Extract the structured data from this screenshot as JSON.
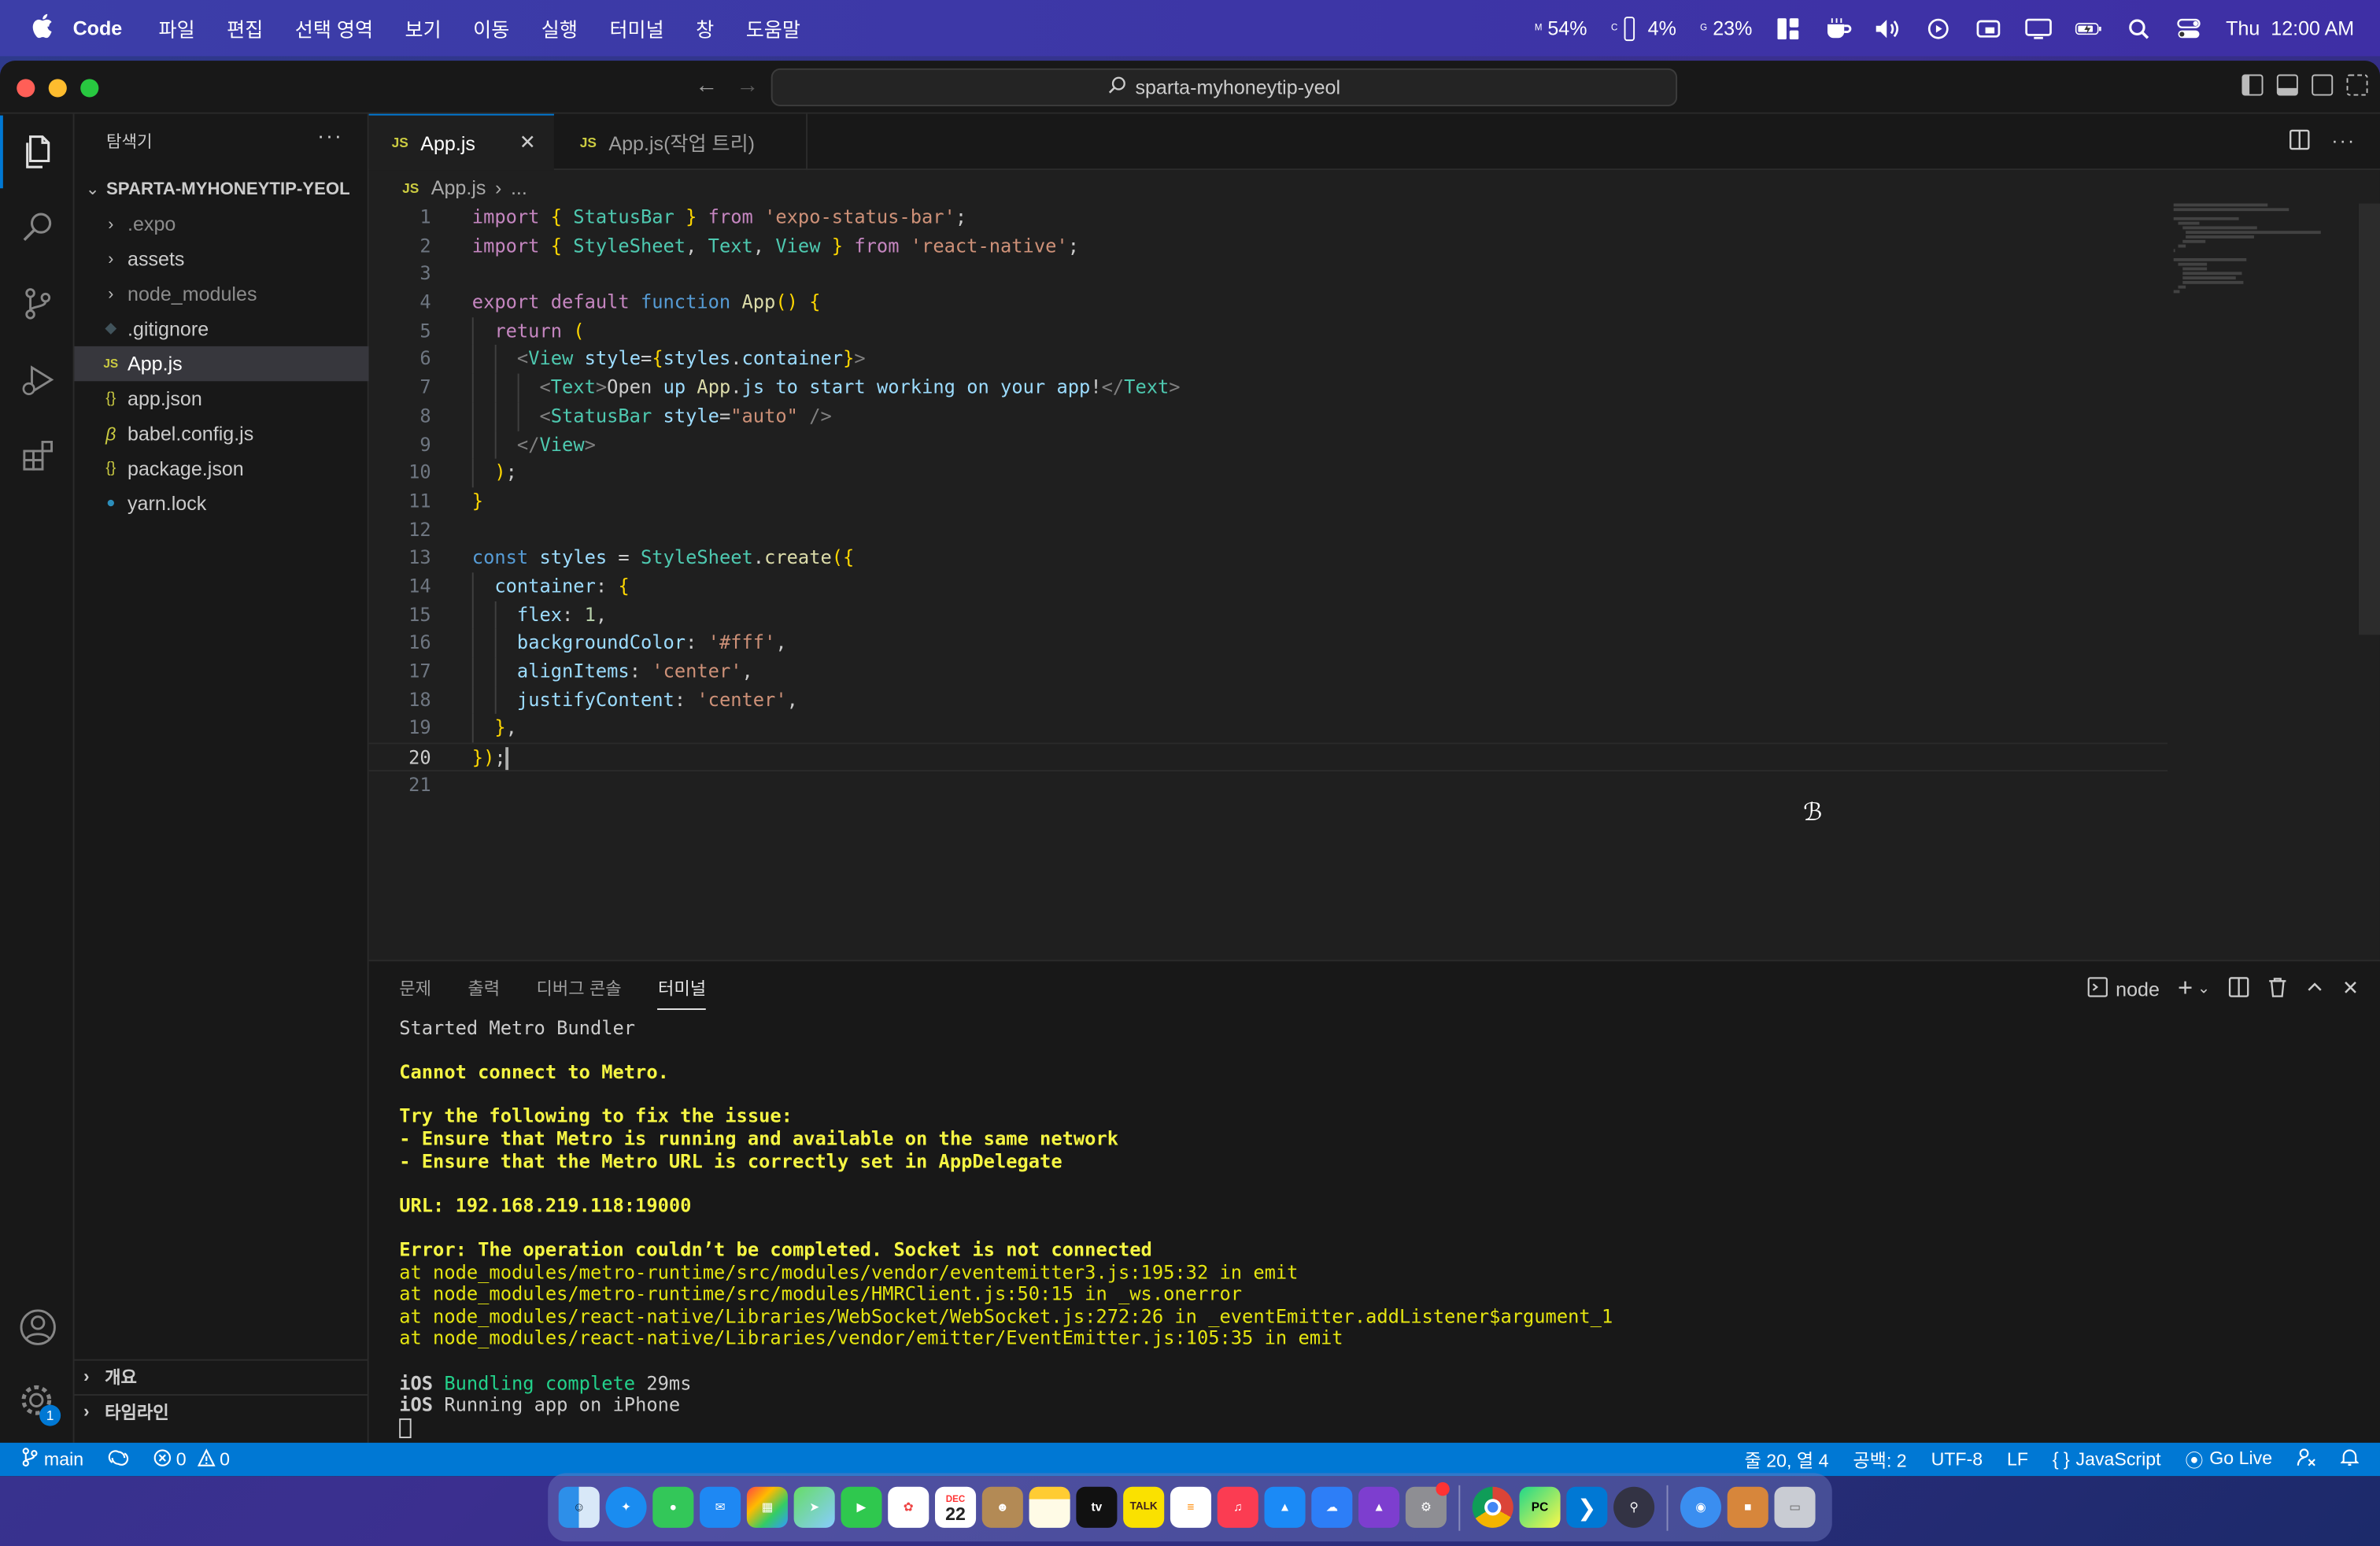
{
  "menubar": {
    "app_name": "Code",
    "items": [
      "파일",
      "편집",
      "선택 영역",
      "보기",
      "이동",
      "실행",
      "터미널",
      "창",
      "도움말"
    ],
    "mem_label": "M",
    "mem_value": "54%",
    "cpu_label": "C",
    "cpu_value": "4%",
    "gpu_label": "G",
    "gpu_value": "23%",
    "clock": "Thu  12:00 AM"
  },
  "titlebar": {
    "search_text": "sparta-myhoneytip-yeol"
  },
  "activity": {
    "settings_badge": "1"
  },
  "sidebar": {
    "title": "탐색기",
    "more": "···",
    "root": "SPARTA-MYHONEYTIP-YEOL",
    "items": [
      {
        "name": ".expo",
        "kind": "folder"
      },
      {
        "name": "assets",
        "kind": "folder"
      },
      {
        "name": "node_modules",
        "kind": "folder"
      },
      {
        "name": ".gitignore",
        "kind": "file"
      },
      {
        "name": "App.js",
        "kind": "js"
      },
      {
        "name": "app.json",
        "kind": "json"
      },
      {
        "name": "babel.config.js",
        "kind": "babel"
      },
      {
        "name": "package.json",
        "kind": "json"
      },
      {
        "name": "yarn.lock",
        "kind": "yarn"
      }
    ],
    "outline": "개요",
    "timeline": "타임라인"
  },
  "editor": {
    "tabs": [
      {
        "label": "App.js",
        "badge": "JS"
      },
      {
        "label": "App.js(작업 트리)",
        "badge": "JS"
      }
    ],
    "breadcrumb_badge": "JS",
    "breadcrumb_file": "App.js",
    "breadcrumb_more": "...",
    "current_line": 20,
    "lines": [
      "import { StatusBar } from 'expo-status-bar';",
      "import { StyleSheet, Text, View } from 'react-native';",
      "",
      "export default function App() {",
      "  return (",
      "    <View style={styles.container}>",
      "      <Text>Open up App.js to start working on your app!</Text>",
      "      <StatusBar style=\"auto\" />",
      "    </View>",
      "  );",
      "}",
      "",
      "const styles = StyleSheet.create({",
      "  container: {",
      "    flex: 1,",
      "    backgroundColor: '#fff',",
      "    alignItems: 'center',",
      "    justifyContent: 'center',",
      "  },",
      "});",
      ""
    ]
  },
  "panel": {
    "tabs": [
      "문제",
      "출력",
      "디버그 콘솔",
      "터미널"
    ],
    "active_tab": "터미널",
    "shell": "node",
    "terminal": [
      {
        "text": "Started Metro Bundler",
        "style": "normal"
      },
      {
        "text": "",
        "style": "normal"
      },
      {
        "text": "Cannot connect to Metro.",
        "style": "yellow-bold"
      },
      {
        "text": "",
        "style": "normal"
      },
      {
        "text": "Try the following to fix the issue:",
        "style": "yellow-bold"
      },
      {
        "text": "- Ensure that Metro is running and available on the same network",
        "style": "yellow-bold"
      },
      {
        "text": "- Ensure that the Metro URL is correctly set in AppDelegate",
        "style": "yellow-bold"
      },
      {
        "text": "",
        "style": "normal"
      },
      {
        "text": "URL: 192.168.219.118:19000",
        "style": "yellow-bold"
      },
      {
        "text": "",
        "style": "normal"
      },
      {
        "text": "Error: The operation couldn’t be completed. Socket is not connected",
        "style": "yellow-bold"
      },
      {
        "text": "at node_modules/metro-runtime/src/modules/vendor/eventemitter3.js:195:32 in emit",
        "style": "yellow"
      },
      {
        "text": "at node_modules/metro-runtime/src/modules/HMRClient.js:50:15 in _ws.onerror",
        "style": "yellow"
      },
      {
        "text": "at node_modules/react-native/Libraries/WebSocket/WebSocket.js:272:26 in _eventEmitter.addListener$argument_1",
        "style": "yellow"
      },
      {
        "text": "at node_modules/react-native/Libraries/vendor/emitter/EventEmitter.js:105:35 in emit",
        "style": "yellow"
      },
      {
        "text": "",
        "style": "normal"
      },
      {
        "text": "iOS Bundling complete 29ms",
        "style": "ios-green"
      },
      {
        "text": "iOS Running app on iPhone",
        "style": "ios"
      }
    ]
  },
  "statusbar": {
    "branch": "main",
    "errors": "0",
    "warnings": "0",
    "position": "줄 20, 열 4",
    "spaces": "공백: 2",
    "encoding": "UTF-8",
    "eol": "LF",
    "language": "JavaScript",
    "golive": "Go Live"
  },
  "dock": {
    "calendar_month": "DEC",
    "calendar_day": "22",
    "tv_label": "tv",
    "talk_label": "TALK",
    "pycharm_label": "PC"
  },
  "colors": {
    "accent": "#0078d4",
    "editor_bg": "#1f1f1f",
    "sidebar_bg": "#181818",
    "terminal_yellow": "#f5f543",
    "terminal_green": "#23d18b"
  }
}
